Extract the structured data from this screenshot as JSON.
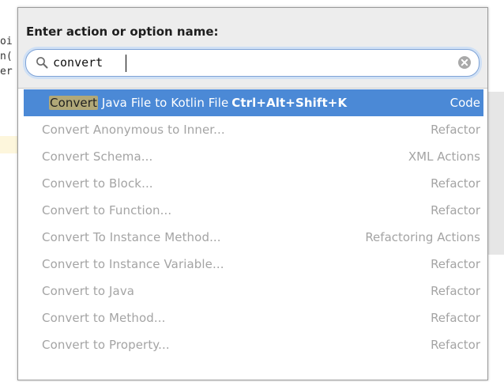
{
  "editor": {
    "lines": [
      "oi",
      "n(",
      "er"
    ]
  },
  "popup": {
    "header_label": "Enter action or option name:",
    "search": {
      "value": "convert"
    }
  },
  "results": [
    {
      "match": "Convert",
      "rest": " Java File to Kotlin File",
      "shortcut": "Ctrl+Alt+Shift+K",
      "group": "Code",
      "selected": true
    },
    {
      "label": "Convert Anonymous to Inner...",
      "group": "Refactor"
    },
    {
      "label": "Convert Schema...",
      "group": "XML Actions"
    },
    {
      "label": "Convert to Block...",
      "group": "Refactor"
    },
    {
      "label": "Convert to Function...",
      "group": "Refactor"
    },
    {
      "label": "Convert To Instance Method...",
      "group": "Refactoring Actions"
    },
    {
      "label": "Convert to Instance Variable...",
      "group": "Refactor"
    },
    {
      "label": "Convert to Java",
      "group": "Refactor"
    },
    {
      "label": "Convert to Method...",
      "group": "Refactor"
    },
    {
      "label": "Convert to Property...",
      "group": "Refactor"
    }
  ],
  "colors": {
    "selection": "#4b89d6",
    "match_highlight": "#b1a878",
    "search_focus": "#7fa3d6"
  },
  "icons": {
    "search": "search-icon",
    "clear": "clear-icon"
  }
}
